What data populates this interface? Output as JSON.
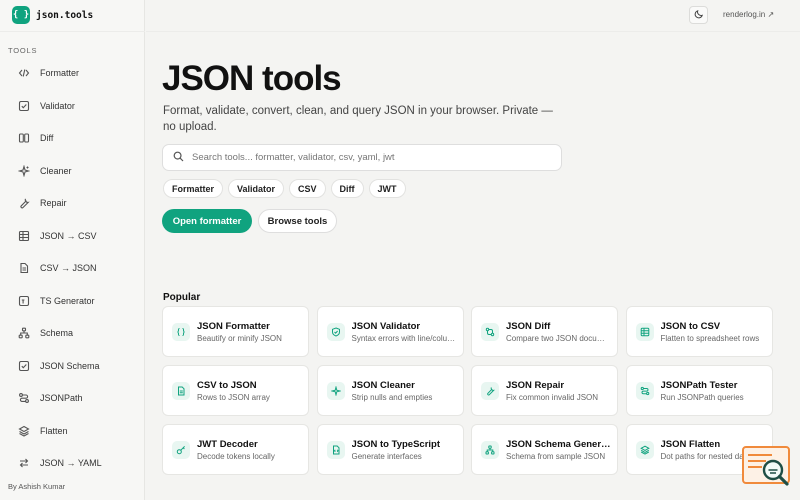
{
  "brand": {
    "logo_text": "{ }",
    "name": "json.tools"
  },
  "sidebar": {
    "section_label": "TOOLS",
    "items": [
      {
        "label": "Formatter",
        "icon": "code-icon"
      },
      {
        "label": "Validator",
        "icon": "check-square-icon"
      },
      {
        "label": "Diff",
        "icon": "columns-icon"
      },
      {
        "label": "Cleaner",
        "icon": "sparkles-icon"
      },
      {
        "label": "Repair",
        "icon": "wrench-icon"
      },
      {
        "label": "JSON → CSV",
        "icon": "table-icon"
      },
      {
        "label": "CSV → JSON",
        "icon": "file-text-icon"
      },
      {
        "label": "TS Generator",
        "icon": "ts-icon"
      },
      {
        "label": "Schema",
        "icon": "hierarchy-icon"
      },
      {
        "label": "JSON Schema",
        "icon": "check-square-icon"
      },
      {
        "label": "JSONPath",
        "icon": "path-icon"
      },
      {
        "label": "Flatten",
        "icon": "layers-icon"
      },
      {
        "label": "JSON → YAML",
        "icon": "arrows-icon"
      }
    ],
    "footer": "By Ashish Kumar"
  },
  "header": {
    "link_text": "renderlog.in ↗"
  },
  "hero": {
    "title": "JSON tools",
    "subtitle": "Format, validate, convert, clean, and query JSON in your browser. Private — no upload.",
    "search_placeholder": "Search tools... formatter, validator, csv, yaml, jwt",
    "chips": [
      "Formatter",
      "Validator",
      "CSV",
      "Diff",
      "JWT"
    ],
    "primary_cta": "Open formatter",
    "secondary_cta": "Browse tools"
  },
  "popular": {
    "heading": "Popular",
    "cards": [
      {
        "title": "JSON Formatter",
        "desc": "Beautify or minify JSON",
        "icon": "braces-icon"
      },
      {
        "title": "JSON Validator",
        "desc": "Syntax errors with line/column",
        "icon": "shield-check-icon"
      },
      {
        "title": "JSON Diff",
        "desc": "Compare two JSON documents",
        "icon": "diff-icon"
      },
      {
        "title": "JSON to CSV",
        "desc": "Flatten to spreadsheet rows",
        "icon": "table-icon"
      },
      {
        "title": "CSV to JSON",
        "desc": "Rows to JSON array",
        "icon": "file-text-icon"
      },
      {
        "title": "JSON Cleaner",
        "desc": "Strip nulls and empties",
        "icon": "sparkles-icon"
      },
      {
        "title": "JSON Repair",
        "desc": "Fix common invalid JSON",
        "icon": "wrench-icon"
      },
      {
        "title": "JSONPath Tester",
        "desc": "Run JSONPath queries",
        "icon": "route-icon"
      },
      {
        "title": "JWT Decoder",
        "desc": "Decode tokens locally",
        "icon": "key-icon"
      },
      {
        "title": "JSON to TypeScript",
        "desc": "Generate interfaces",
        "icon": "file-code-icon"
      },
      {
        "title": "JSON Schema Generator",
        "desc": "Schema from sample JSON",
        "icon": "hierarchy-icon"
      },
      {
        "title": "JSON Flatten",
        "desc": "Dot paths for nested data",
        "icon": "layers-icon"
      }
    ]
  },
  "colors": {
    "accent": "#10a37f",
    "accent_soft": "#e8f6f1",
    "background": "#f4f4f2"
  }
}
